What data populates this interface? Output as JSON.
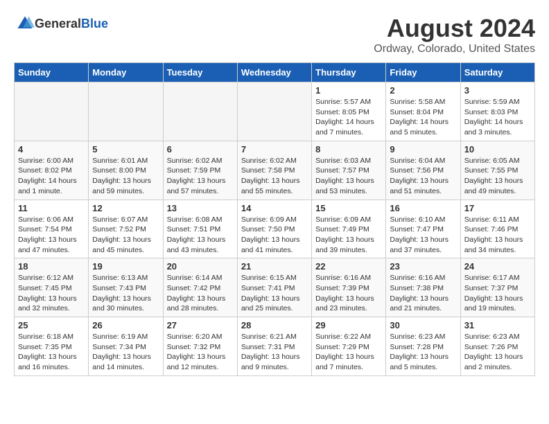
{
  "header": {
    "logo_general": "General",
    "logo_blue": "Blue",
    "title": "August 2024",
    "subtitle": "Ordway, Colorado, United States"
  },
  "calendar": {
    "days_of_week": [
      "Sunday",
      "Monday",
      "Tuesday",
      "Wednesday",
      "Thursday",
      "Friday",
      "Saturday"
    ],
    "weeks": [
      [
        {
          "day": "",
          "empty": true
        },
        {
          "day": "",
          "empty": true
        },
        {
          "day": "",
          "empty": true
        },
        {
          "day": "",
          "empty": true
        },
        {
          "day": "1",
          "sunrise": "Sunrise: 5:57 AM",
          "sunset": "Sunset: 8:05 PM",
          "daylight": "Daylight: 14 hours and 7 minutes."
        },
        {
          "day": "2",
          "sunrise": "Sunrise: 5:58 AM",
          "sunset": "Sunset: 8:04 PM",
          "daylight": "Daylight: 14 hours and 5 minutes."
        },
        {
          "day": "3",
          "sunrise": "Sunrise: 5:59 AM",
          "sunset": "Sunset: 8:03 PM",
          "daylight": "Daylight: 14 hours and 3 minutes."
        }
      ],
      [
        {
          "day": "4",
          "sunrise": "Sunrise: 6:00 AM",
          "sunset": "Sunset: 8:02 PM",
          "daylight": "Daylight: 14 hours and 1 minute."
        },
        {
          "day": "5",
          "sunrise": "Sunrise: 6:01 AM",
          "sunset": "Sunset: 8:00 PM",
          "daylight": "Daylight: 13 hours and 59 minutes."
        },
        {
          "day": "6",
          "sunrise": "Sunrise: 6:02 AM",
          "sunset": "Sunset: 7:59 PM",
          "daylight": "Daylight: 13 hours and 57 minutes."
        },
        {
          "day": "7",
          "sunrise": "Sunrise: 6:02 AM",
          "sunset": "Sunset: 7:58 PM",
          "daylight": "Daylight: 13 hours and 55 minutes."
        },
        {
          "day": "8",
          "sunrise": "Sunrise: 6:03 AM",
          "sunset": "Sunset: 7:57 PM",
          "daylight": "Daylight: 13 hours and 53 minutes."
        },
        {
          "day": "9",
          "sunrise": "Sunrise: 6:04 AM",
          "sunset": "Sunset: 7:56 PM",
          "daylight": "Daylight: 13 hours and 51 minutes."
        },
        {
          "day": "10",
          "sunrise": "Sunrise: 6:05 AM",
          "sunset": "Sunset: 7:55 PM",
          "daylight": "Daylight: 13 hours and 49 minutes."
        }
      ],
      [
        {
          "day": "11",
          "sunrise": "Sunrise: 6:06 AM",
          "sunset": "Sunset: 7:54 PM",
          "daylight": "Daylight: 13 hours and 47 minutes."
        },
        {
          "day": "12",
          "sunrise": "Sunrise: 6:07 AM",
          "sunset": "Sunset: 7:52 PM",
          "daylight": "Daylight: 13 hours and 45 minutes."
        },
        {
          "day": "13",
          "sunrise": "Sunrise: 6:08 AM",
          "sunset": "Sunset: 7:51 PM",
          "daylight": "Daylight: 13 hours and 43 minutes."
        },
        {
          "day": "14",
          "sunrise": "Sunrise: 6:09 AM",
          "sunset": "Sunset: 7:50 PM",
          "daylight": "Daylight: 13 hours and 41 minutes."
        },
        {
          "day": "15",
          "sunrise": "Sunrise: 6:09 AM",
          "sunset": "Sunset: 7:49 PM",
          "daylight": "Daylight: 13 hours and 39 minutes."
        },
        {
          "day": "16",
          "sunrise": "Sunrise: 6:10 AM",
          "sunset": "Sunset: 7:47 PM",
          "daylight": "Daylight: 13 hours and 37 minutes."
        },
        {
          "day": "17",
          "sunrise": "Sunrise: 6:11 AM",
          "sunset": "Sunset: 7:46 PM",
          "daylight": "Daylight: 13 hours and 34 minutes."
        }
      ],
      [
        {
          "day": "18",
          "sunrise": "Sunrise: 6:12 AM",
          "sunset": "Sunset: 7:45 PM",
          "daylight": "Daylight: 13 hours and 32 minutes."
        },
        {
          "day": "19",
          "sunrise": "Sunrise: 6:13 AM",
          "sunset": "Sunset: 7:43 PM",
          "daylight": "Daylight: 13 hours and 30 minutes."
        },
        {
          "day": "20",
          "sunrise": "Sunrise: 6:14 AM",
          "sunset": "Sunset: 7:42 PM",
          "daylight": "Daylight: 13 hours and 28 minutes."
        },
        {
          "day": "21",
          "sunrise": "Sunrise: 6:15 AM",
          "sunset": "Sunset: 7:41 PM",
          "daylight": "Daylight: 13 hours and 25 minutes."
        },
        {
          "day": "22",
          "sunrise": "Sunrise: 6:16 AM",
          "sunset": "Sunset: 7:39 PM",
          "daylight": "Daylight: 13 hours and 23 minutes."
        },
        {
          "day": "23",
          "sunrise": "Sunrise: 6:16 AM",
          "sunset": "Sunset: 7:38 PM",
          "daylight": "Daylight: 13 hours and 21 minutes."
        },
        {
          "day": "24",
          "sunrise": "Sunrise: 6:17 AM",
          "sunset": "Sunset: 7:37 PM",
          "daylight": "Daylight: 13 hours and 19 minutes."
        }
      ],
      [
        {
          "day": "25",
          "sunrise": "Sunrise: 6:18 AM",
          "sunset": "Sunset: 7:35 PM",
          "daylight": "Daylight: 13 hours and 16 minutes."
        },
        {
          "day": "26",
          "sunrise": "Sunrise: 6:19 AM",
          "sunset": "Sunset: 7:34 PM",
          "daylight": "Daylight: 13 hours and 14 minutes."
        },
        {
          "day": "27",
          "sunrise": "Sunrise: 6:20 AM",
          "sunset": "Sunset: 7:32 PM",
          "daylight": "Daylight: 13 hours and 12 minutes."
        },
        {
          "day": "28",
          "sunrise": "Sunrise: 6:21 AM",
          "sunset": "Sunset: 7:31 PM",
          "daylight": "Daylight: 13 hours and 9 minutes."
        },
        {
          "day": "29",
          "sunrise": "Sunrise: 6:22 AM",
          "sunset": "Sunset: 7:29 PM",
          "daylight": "Daylight: 13 hours and 7 minutes."
        },
        {
          "day": "30",
          "sunrise": "Sunrise: 6:23 AM",
          "sunset": "Sunset: 7:28 PM",
          "daylight": "Daylight: 13 hours and 5 minutes."
        },
        {
          "day": "31",
          "sunrise": "Sunrise: 6:23 AM",
          "sunset": "Sunset: 7:26 PM",
          "daylight": "Daylight: 13 hours and 2 minutes."
        }
      ]
    ]
  }
}
